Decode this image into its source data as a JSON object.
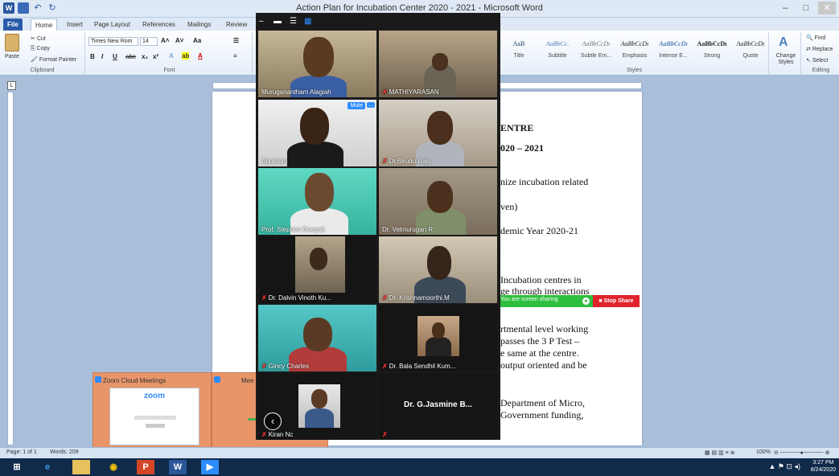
{
  "window": {
    "title": "Action Plan for Incubation Center 2020 - 2021  -  Microsoft Word",
    "minimize": "–",
    "maximize": "□",
    "close": "✕"
  },
  "ribbon_tabs": [
    "File",
    "Home",
    "Insert",
    "Page Layout",
    "References",
    "Mailings",
    "Review"
  ],
  "clipboard": {
    "paste": "Paste",
    "cut": "Cut",
    "copy": "Copy",
    "format_painter": "Format Painter",
    "group": "Clipboard"
  },
  "font": {
    "name": "Times New Rom",
    "size": "14",
    "group": "Font",
    "grow": "A˄",
    "shrink": "A˅",
    "case": "Aa",
    "bold": "B",
    "italic": "I",
    "underline": "U",
    "strike": "abc",
    "sub": "x₂",
    "sup": "x²"
  },
  "styles": {
    "group": "Styles",
    "items": [
      {
        "sample": "AaB",
        "name": "Title"
      },
      {
        "sample": "AaBbCc.",
        "name": "Subtitle"
      },
      {
        "sample": "AaBbCcDı",
        "name": "Subtle Em..."
      },
      {
        "sample": "AaBbCcDı",
        "name": "Emphasis"
      },
      {
        "sample": "AaBbCcDı",
        "name": "Intense E..."
      },
      {
        "sample": "AaBbCcDı",
        "name": "Strong"
      },
      {
        "sample": "AaBbCcDı",
        "name": "Quote"
      }
    ],
    "change_styles": "Change Styles"
  },
  "editing": {
    "group": "Editing",
    "find": "Find",
    "replace": "Replace",
    "select": "Select"
  },
  "document_lines": [
    "ENTRE",
    "020 – 2021",
    "nize incubation related",
    "ven)",
    "demic Year 2020-21",
    "Incubation centres in",
    "ge through interactions",
    "rtmental level working",
    "passes the 3 P Test –",
    "e same at the centre.",
    "output oriented and be",
    "Department of Micro,",
    "Government funding,"
  ],
  "share_bar": {
    "message": "You are screen sharing",
    "stop": "Stop Share"
  },
  "zoom": {
    "controls": [
      "–",
      "▬",
      "☰",
      "▦"
    ],
    "participants": [
      {
        "name": "Muruganantham Alagiah",
        "muted": false
      },
      {
        "name": "MATHIYARASAN",
        "muted": true
      },
      {
        "name": "Abraham",
        "muted": false,
        "mute_button": "Mute",
        "more": "…"
      },
      {
        "name": "Dr.Birudu Raju",
        "muted": true
      },
      {
        "name": "Prof. Stephen Deepak",
        "muted": false
      },
      {
        "name": "Dr. Velmurugan R",
        "muted": false
      },
      {
        "name": "Dr. Dalvin Vinoth Ku...",
        "muted": true
      },
      {
        "name": "Dr. Krishnamoorthi.M",
        "muted": true
      },
      {
        "name": "Gincy Charles",
        "muted": true
      },
      {
        "name": "Dr. Bala Sendhil Kum...",
        "muted": true
      },
      {
        "name": "Kiran Nc",
        "muted": true
      },
      {
        "name": "Dr. G.Jasmine B...",
        "muted": true
      }
    ],
    "prev": "‹"
  },
  "zoom_windows": {
    "first_title": "Zoom Cloud Meetings",
    "first_logo": "zoom",
    "second_title": "Mee"
  },
  "status": {
    "page": "Page: 1 of 1",
    "words": "Words: 209",
    "zoom": "100%"
  },
  "taskbar": {
    "time": "3:27 PM",
    "date": "8/24/2020"
  }
}
